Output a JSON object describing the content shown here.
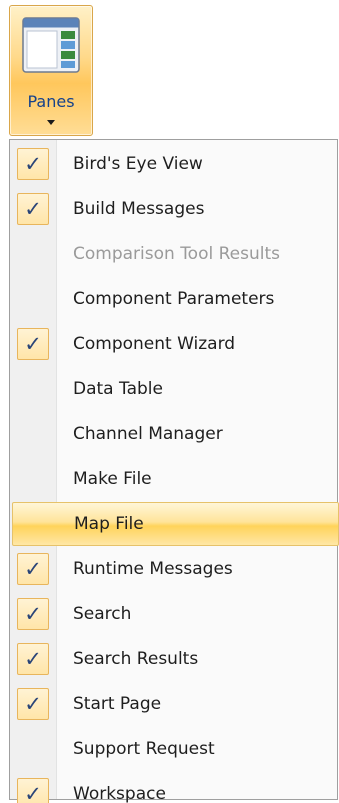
{
  "ribbon": {
    "panes_label": "Panes"
  },
  "menu": {
    "check_glyph": "✓",
    "items": [
      {
        "label": "Bird's Eye View",
        "checked": true,
        "disabled": false,
        "highlighted": false
      },
      {
        "label": "Build Messages",
        "checked": true,
        "disabled": false,
        "highlighted": false
      },
      {
        "label": "Comparison Tool Results",
        "checked": false,
        "disabled": true,
        "highlighted": false
      },
      {
        "label": "Component Parameters",
        "checked": false,
        "disabled": false,
        "highlighted": false
      },
      {
        "label": "Component Wizard",
        "checked": true,
        "disabled": false,
        "highlighted": false
      },
      {
        "label": "Data Table",
        "checked": false,
        "disabled": false,
        "highlighted": false
      },
      {
        "label": "Channel Manager",
        "checked": false,
        "disabled": false,
        "highlighted": false
      },
      {
        "label": "Make File",
        "checked": false,
        "disabled": false,
        "highlighted": false
      },
      {
        "label": "Map File",
        "checked": false,
        "disabled": false,
        "highlighted": true
      },
      {
        "label": "Runtime Messages",
        "checked": true,
        "disabled": false,
        "highlighted": false
      },
      {
        "label": "Search",
        "checked": true,
        "disabled": false,
        "highlighted": false
      },
      {
        "label": "Search Results",
        "checked": true,
        "disabled": false,
        "highlighted": false
      },
      {
        "label": "Start Page",
        "checked": true,
        "disabled": false,
        "highlighted": false
      },
      {
        "label": "Support Request",
        "checked": false,
        "disabled": false,
        "highlighted": false
      },
      {
        "label": "Workspace",
        "checked": true,
        "disabled": false,
        "highlighted": false
      }
    ]
  },
  "colors": {
    "accent": "#ffd35a",
    "text": "#1e1e1e",
    "disabled_text": "#9a9a9a",
    "label_blue": "#15428b",
    "check_color": "#2a4578"
  }
}
